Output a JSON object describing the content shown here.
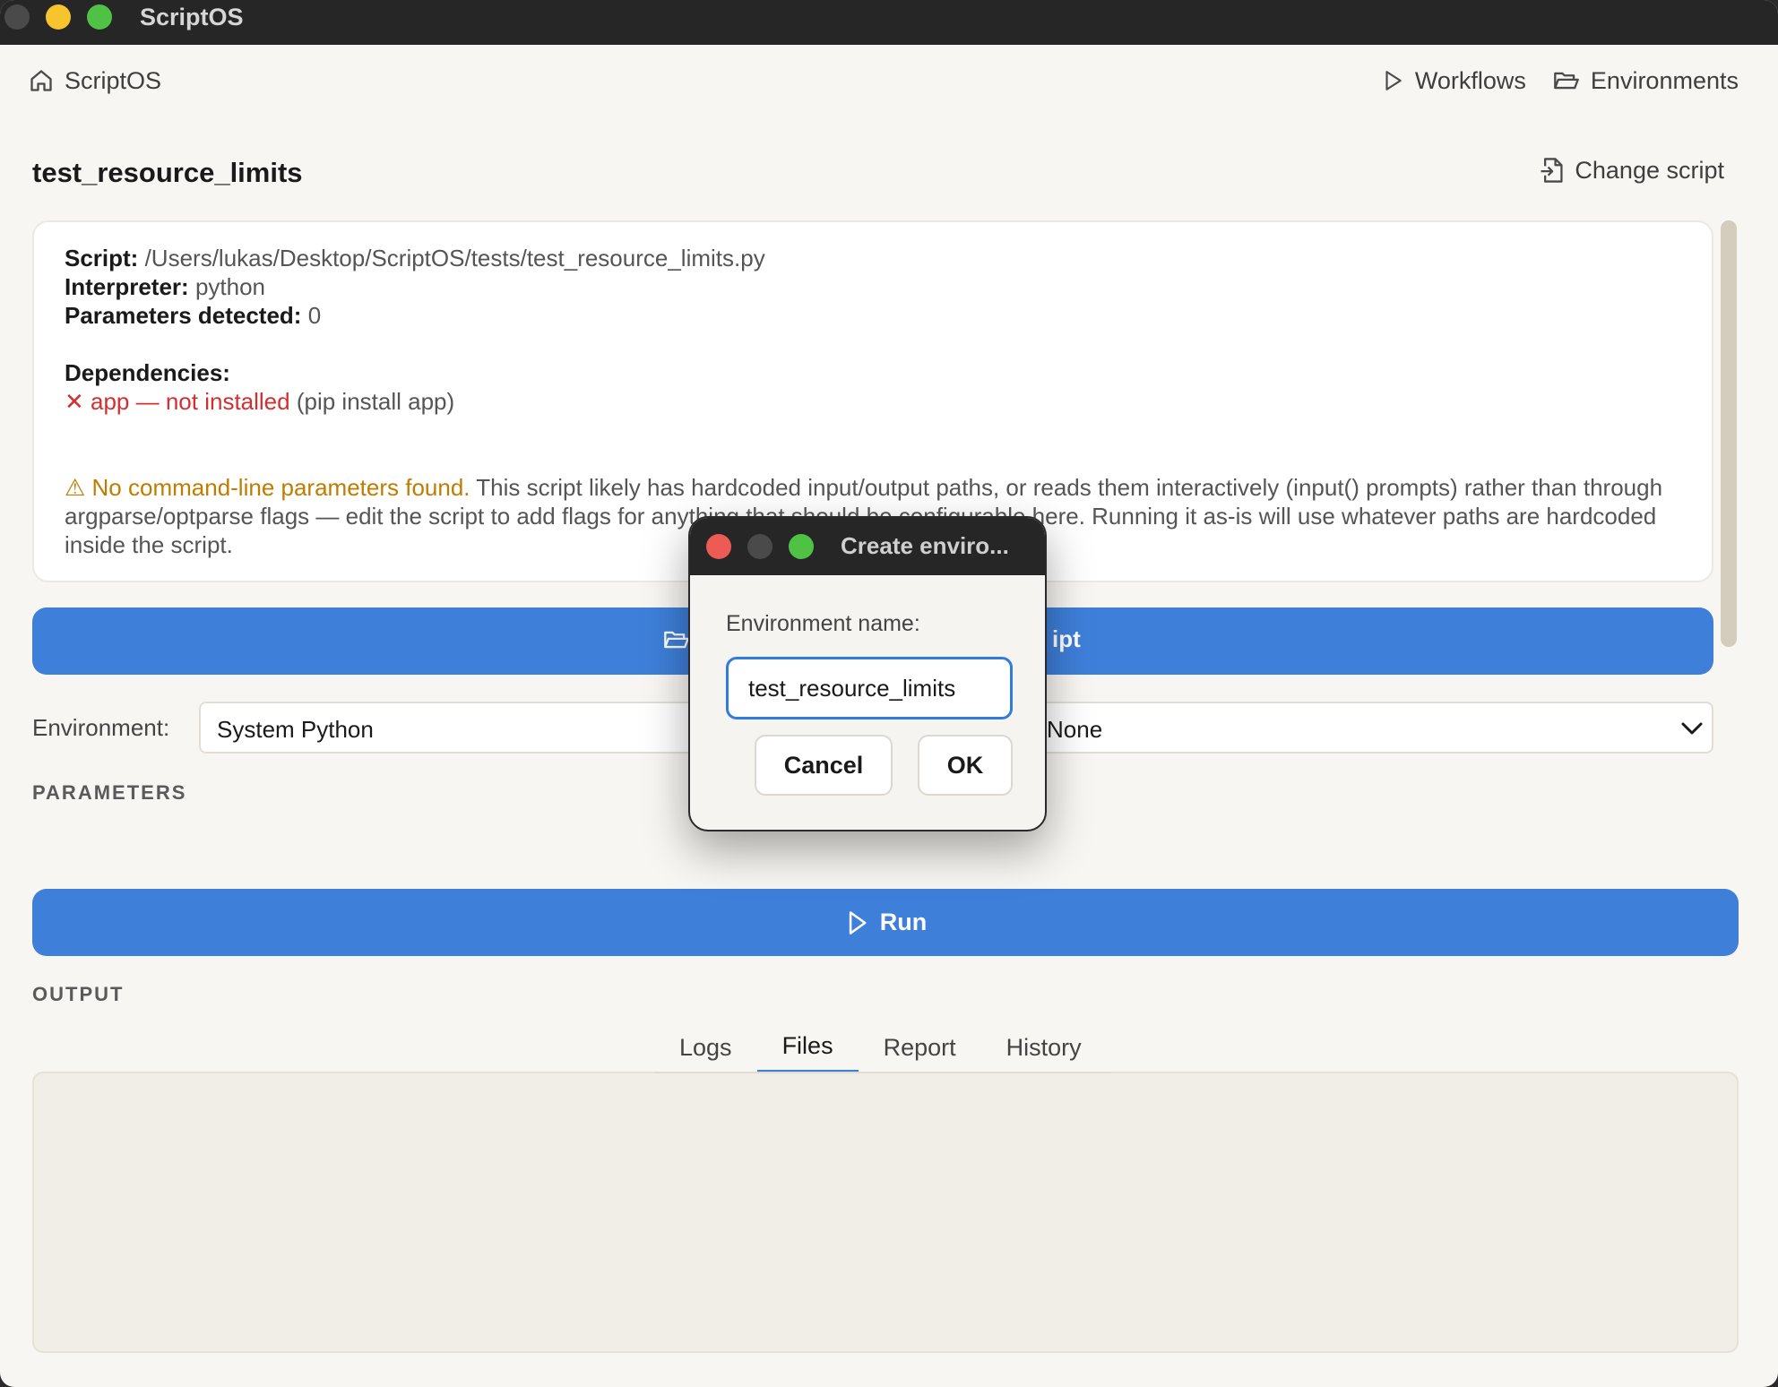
{
  "window": {
    "title": "ScriptOS"
  },
  "nav": {
    "home": "ScriptOS",
    "workflows": "Workflows",
    "environments": "Environments"
  },
  "page": {
    "title": "test_resource_limits",
    "change_script": "Change script"
  },
  "info": {
    "script_label": "Script:",
    "script_value": "/Users/lukas/Desktop/ScriptOS/tests/test_resource_limits.py",
    "interpreter_label": "Interpreter:",
    "interpreter_value": "python",
    "params_label": "Parameters detected:",
    "params_value": "0",
    "deps_label": "Dependencies:",
    "dep_error": "✕ app — not installed",
    "dep_hint": "(pip install app)",
    "warning_title": "⚠ No command-line parameters found.",
    "warning_text": "This script likely has hardcoded input/output paths, or reads them interactively (input() prompts) rather than through argparse/optparse flags — edit the script to add flags for anything that should be configurable here. Running it as-is will use whatever paths are hardcoded inside the script."
  },
  "open_button": {
    "label_right": "ipt"
  },
  "environment": {
    "label": "Environment:",
    "value": "System Python",
    "requirements_value": "None"
  },
  "parameters": {
    "heading": "PARAMETERS"
  },
  "run": {
    "label": "Run"
  },
  "output": {
    "heading": "OUTPUT",
    "tabs": [
      "Logs",
      "Files",
      "Report",
      "History"
    ],
    "active_tab": "Files"
  },
  "dialog": {
    "title": "Create enviro...",
    "field_label": "Environment name:",
    "field_value": "test_resource_limits",
    "cancel": "Cancel",
    "ok": "OK"
  },
  "colors": {
    "accent": "#3e7fd9",
    "error": "#d32f2f",
    "warning": "#c17c00",
    "titlebar": "#262626"
  }
}
